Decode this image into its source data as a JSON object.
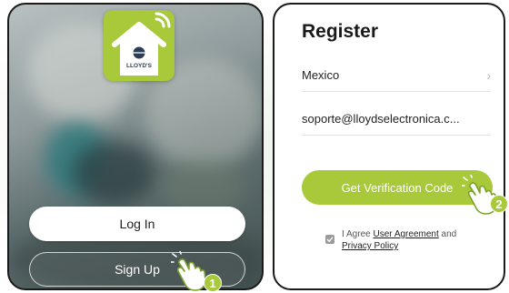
{
  "left_screen": {
    "brand_logo_text": "LLOYD'S",
    "login_button": "Log In",
    "signup_button": "Sign Up"
  },
  "right_screen": {
    "title": "Register",
    "country": "Mexico",
    "email": "soporte@lloydselectronica.c...",
    "verify_button": "Get Verification Code",
    "agree_prefix": "I Agree",
    "user_agreement_link": "User Agreement",
    "and_text": "and",
    "privacy_policy_link": "Privacy Policy"
  },
  "steps": {
    "step1": "1",
    "step2": "2"
  },
  "icons": {
    "logo": "house-wifi-icon",
    "chevron": "chevron-right-icon",
    "checkbox": "checkbox-icon",
    "pointer": "hand-pointer-icon"
  },
  "colors": {
    "accent": "#a8c93a",
    "text": "#1a1a1a"
  }
}
